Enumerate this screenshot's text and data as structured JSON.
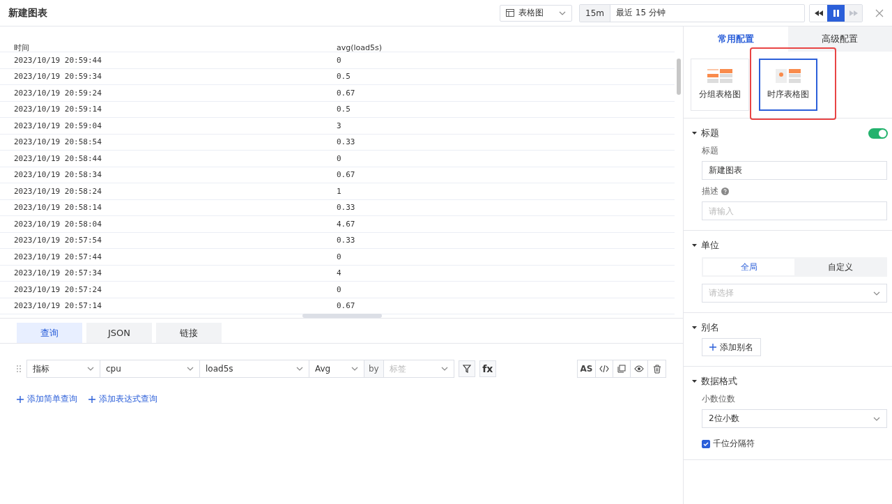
{
  "window": {
    "title": "新建图表"
  },
  "toolbar": {
    "chart_type": "表格图",
    "time_badge": "15m",
    "time_range": "最近 15 分钟",
    "playback": [
      {
        "kind": "rewind",
        "selected": false,
        "disabled": false
      },
      {
        "kind": "pause",
        "selected": true,
        "disabled": false
      },
      {
        "kind": "forward",
        "selected": false,
        "disabled": true
      }
    ]
  },
  "table": {
    "columns": [
      "时间",
      "avg(load5s)"
    ],
    "rows": [
      [
        "2023/10/19 20:59:44",
        "0"
      ],
      [
        "2023/10/19 20:59:34",
        "0.5"
      ],
      [
        "2023/10/19 20:59:24",
        "0.67"
      ],
      [
        "2023/10/19 20:59:14",
        "0.5"
      ],
      [
        "2023/10/19 20:59:04",
        "3"
      ],
      [
        "2023/10/19 20:58:54",
        "0.33"
      ],
      [
        "2023/10/19 20:58:44",
        "0"
      ],
      [
        "2023/10/19 20:58:34",
        "0.67"
      ],
      [
        "2023/10/19 20:58:24",
        "1"
      ],
      [
        "2023/10/19 20:58:14",
        "0.33"
      ],
      [
        "2023/10/19 20:58:04",
        "4.67"
      ],
      [
        "2023/10/19 20:57:54",
        "0.33"
      ],
      [
        "2023/10/19 20:57:44",
        "0"
      ],
      [
        "2023/10/19 20:57:34",
        "4"
      ],
      [
        "2023/10/19 20:57:24",
        "0"
      ],
      [
        "2023/10/19 20:57:14",
        "0.67"
      ]
    ]
  },
  "query_tabs": [
    {
      "label": "查询",
      "selected": true
    },
    {
      "label": "JSON",
      "selected": false
    },
    {
      "label": "链接",
      "selected": false
    }
  ],
  "query": {
    "selects": [
      {
        "kind": "select",
        "value": "指标"
      },
      {
        "kind": "select",
        "value": "cpu"
      },
      {
        "kind": "select",
        "value": "load5s"
      },
      {
        "kind": "select",
        "value": "Avg"
      },
      {
        "kind": "label",
        "value": "by"
      },
      {
        "kind": "select",
        "placeholder": "标签"
      }
    ],
    "fx": "fx",
    "actions": [
      {
        "kind": "text",
        "label": "AS"
      },
      {
        "kind": "code"
      },
      {
        "kind": "copy"
      },
      {
        "kind": "eye"
      },
      {
        "kind": "trash"
      }
    ]
  },
  "add_links": [
    "添加简单查询",
    "添加表达式查询"
  ],
  "config_tabs": [
    {
      "label": "常用配置",
      "selected": true
    },
    {
      "label": "高级配置",
      "selected": false
    }
  ],
  "chart_types": [
    {
      "label": "分组表格图",
      "kind": "group",
      "selected": false,
      "highlighted": false
    },
    {
      "label": "时序表格图",
      "kind": "series",
      "selected": true,
      "highlighted": true
    }
  ],
  "sections": [
    {
      "title": "标题",
      "expanded": true,
      "toggle": true,
      "fields": [
        {
          "kind": "input",
          "label": "标题",
          "value": "新建图表"
        },
        {
          "kind": "input",
          "label": "描述",
          "help": true,
          "placeholder": "请输入"
        }
      ]
    },
    {
      "title": "单位",
      "expanded": true,
      "fields": [
        {
          "kind": "segmented",
          "options": [
            {
              "label": "全局",
              "selected": true
            },
            {
              "label": "自定义",
              "selected": false
            }
          ]
        },
        {
          "kind": "select",
          "placeholder": "请选择"
        }
      ]
    },
    {
      "title": "别名",
      "expanded": true,
      "fields": [
        {
          "kind": "button",
          "label": "添加别名"
        }
      ]
    },
    {
      "title": "数据格式",
      "expanded": true,
      "fields": [
        {
          "kind": "select",
          "label": "小数位数",
          "value": "2位小数"
        },
        {
          "kind": "checkbox",
          "label": "千位分隔符",
          "checked": true
        }
      ]
    }
  ]
}
